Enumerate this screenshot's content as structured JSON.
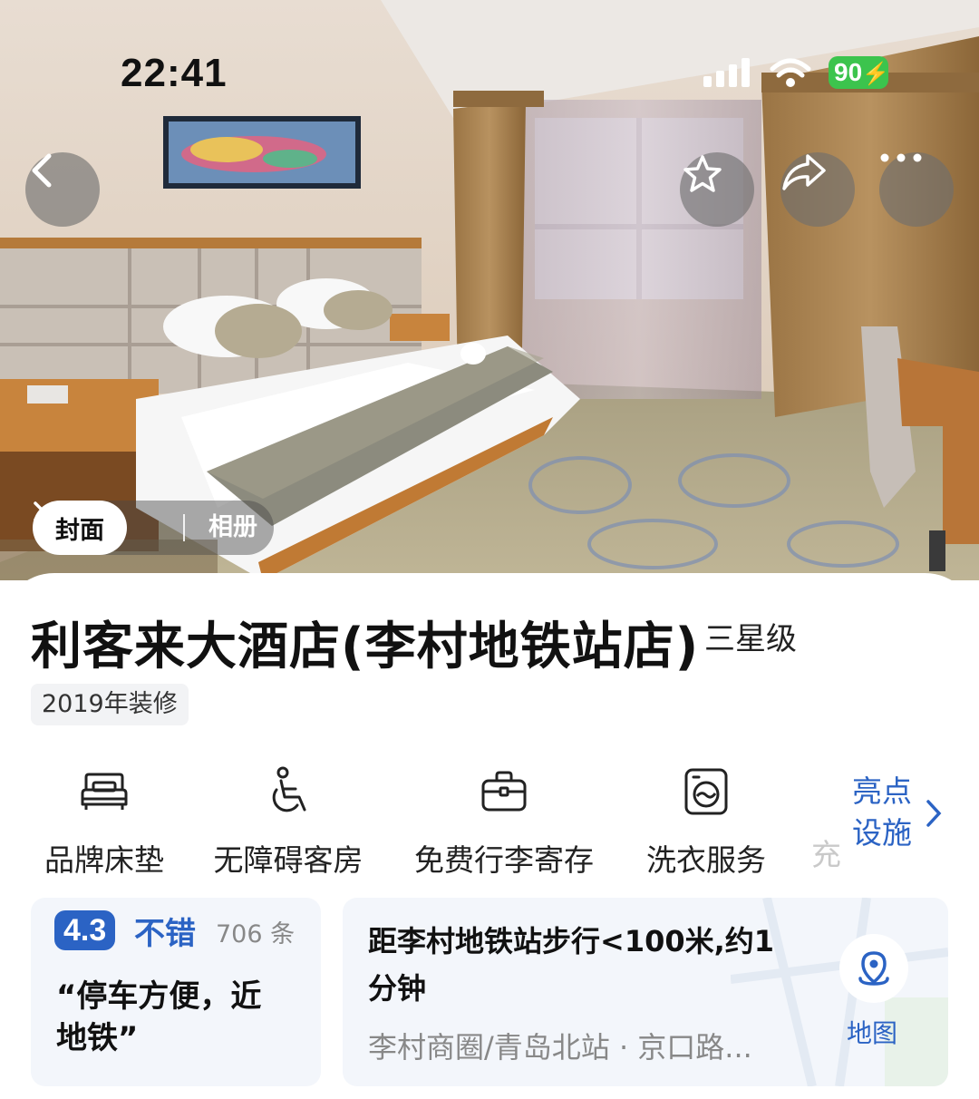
{
  "status_bar": {
    "time": "22:41",
    "battery": "90"
  },
  "hero": {
    "tabs": {
      "cover_label": "封面",
      "album_label": "相册"
    }
  },
  "hotel": {
    "name": "利客来大酒店(李村地铁站店)",
    "star_level": "三星级",
    "renovation_tag": "2019年装修"
  },
  "amenities": [
    {
      "label": "品牌床垫",
      "icon": "bed-icon"
    },
    {
      "label": "无障碍客房",
      "icon": "wheelchair-icon"
    },
    {
      "label": "免费行李寄存",
      "icon": "luggage-icon"
    },
    {
      "label": "洗衣服务",
      "icon": "washing-machine-icon"
    }
  ],
  "amenity_partial": "充",
  "highlights": {
    "line1": "亮点",
    "line2": "设施"
  },
  "rating": {
    "score": "4.3",
    "word": "不错",
    "count": "706 条",
    "quote": "“停车方便，近地铁”"
  },
  "location": {
    "distance": "距李村地铁站步行<100米,约1分钟",
    "area": "李村商圈/青岛北站 · 京口路...",
    "map_label": "地图"
  },
  "colors": {
    "accent_blue": "#2b63c4",
    "battery_green": "#3cc44d",
    "card_bg": "#f3f6fb"
  }
}
